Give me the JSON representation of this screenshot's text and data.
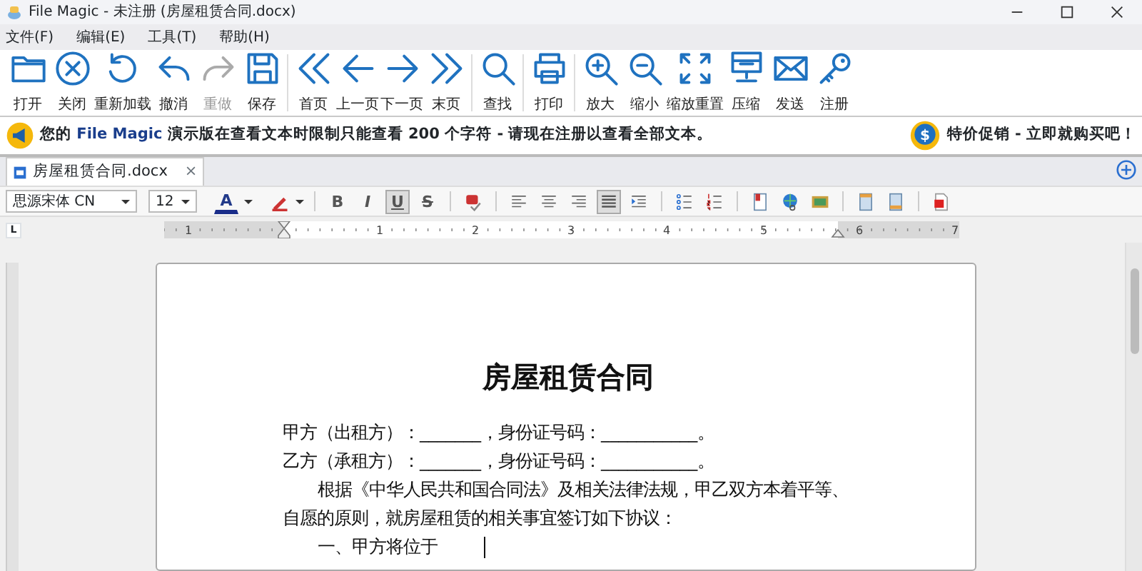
{
  "window": {
    "title": "File Magic - 未注册 (房屋租赁合同.docx)"
  },
  "menu": [
    "文件(F)",
    "编辑(E)",
    "工具(T)",
    "帮助(H)"
  ],
  "toolbar": [
    {
      "buttons": [
        {
          "label": "打开",
          "disabled": false
        },
        {
          "label": "关闭",
          "disabled": false
        },
        {
          "label": "重新加载",
          "disabled": false
        },
        {
          "label": "撤消",
          "disabled": false
        },
        {
          "label": "重做",
          "disabled": true
        },
        {
          "label": "保存",
          "disabled": false
        }
      ]
    },
    {
      "buttons": [
        {
          "label": "首页",
          "disabled": false
        },
        {
          "label": "上一页",
          "disabled": false
        },
        {
          "label": "下一页",
          "disabled": false
        },
        {
          "label": "末页",
          "disabled": false
        }
      ]
    },
    {
      "buttons": [
        {
          "label": "查找",
          "disabled": false
        }
      ]
    },
    {
      "buttons": [
        {
          "label": "打印",
          "disabled": false
        }
      ]
    },
    {
      "buttons": [
        {
          "label": "放大",
          "disabled": false
        },
        {
          "label": "缩小",
          "disabled": false
        },
        {
          "label": "缩放重置",
          "disabled": false
        },
        {
          "label": "压缩",
          "disabled": false
        },
        {
          "label": "发送",
          "disabled": false
        },
        {
          "label": "注册",
          "disabled": false
        }
      ]
    }
  ],
  "banner": {
    "before": "您的 ",
    "product": "File Magic",
    "after": " 演示版在查看文本时限制只能查看 200 个字符 - 请现在注册以查看全部文本。",
    "promo": "特价促销 - 立即就购买吧！",
    "coin_symbol": "$"
  },
  "tabs": [
    {
      "label": "房屋租赁合同.docx",
      "selected": true,
      "close": "×"
    }
  ],
  "format_bar": {
    "font": "思源宋体 CN",
    "size": "12",
    "color_letter": "A",
    "groups": [
      [
        {
          "kind": "text",
          "label": "B",
          "selected": false
        },
        {
          "kind": "text",
          "label": "I",
          "selected": false
        },
        {
          "kind": "text",
          "label": "U",
          "selected": true
        },
        {
          "kind": "text",
          "label": "S",
          "selected": false
        }
      ],
      [
        {
          "kind": "icon",
          "selected": false
        }
      ],
      [
        {
          "kind": "icon",
          "selected": false
        },
        {
          "kind": "icon",
          "selected": false
        },
        {
          "kind": "icon",
          "selected": false
        },
        {
          "kind": "icon",
          "selected": true
        },
        {
          "kind": "icon",
          "selected": false
        }
      ],
      [
        {
          "kind": "icon",
          "selected": false
        },
        {
          "kind": "icon",
          "selected": false
        }
      ],
      [
        {
          "kind": "icon",
          "selected": false
        },
        {
          "kind": "icon",
          "selected": false
        },
        {
          "kind": "icon",
          "selected": false
        }
      ],
      [
        {
          "kind": "icon",
          "selected": false
        },
        {
          "kind": "icon",
          "selected": false
        }
      ],
      [
        {
          "kind": "icon",
          "selected": false
        }
      ]
    ]
  },
  "ruler": {
    "corner": "L",
    "labels": [
      "1",
      "1",
      "2",
      "3",
      "4",
      "5",
      "6",
      "7"
    ]
  },
  "document": {
    "title": "房屋租赁合同",
    "paragraphs": [
      {
        "kind": "line",
        "text": "甲方（出租方）：_______，身份证号码：___________。"
      },
      {
        "kind": "line",
        "text": "乙方（承租方）：_______，身份证号码：___________。"
      },
      {
        "kind": "indent",
        "text": "根据《中华人民共和国合同法》及相关法律法规，甲乙双方本着平等、自愿的原则，就房屋租赁的相关事宜签订如下协议："
      },
      {
        "kind": "indent",
        "text": "一、甲方将位于",
        "cursor": true
      }
    ]
  }
}
